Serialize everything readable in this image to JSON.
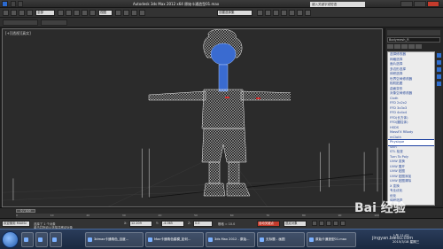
{
  "window": {
    "title": "Autodesk 3ds Max  2012 x64    原始卡通造型01.max",
    "search_placeholder": "键入关键字或短语"
  },
  "toolbar": {
    "selection_filter": "全部",
    "view_dropdown": "视图",
    "named_selection": "创建选择集"
  },
  "viewport": {
    "label": "[+][透视][真实]"
  },
  "command_panel": {
    "object_name": "Bodymesh_R",
    "modifier_list": [
      "选择修改器",
      "网格选择",
      "面片选择",
      "多边形选择",
      "体积选择",
      "世界空间修改器",
      "相机贴图",
      "曲面变形",
      "对象空间修改器",
      "Cloth",
      "FFD 2x2x2",
      "FFD 3x3x3",
      "FFD 4x4x4",
      "FFD(长方体)",
      "FFD(圆柱体)",
      "HSDS",
      "MassFX RBody",
      "mCloth",
      "Physique",
      "Skin",
      "STL 检查",
      "Turn To Poly",
      "UVW 变换",
      "UVW 展开",
      "UVW 贴图",
      "UVW 贴图添加",
      "UVW 贴图清除",
      "X 变换",
      "专业优化",
      "优化",
      "体积选择"
    ],
    "selected_index": 18
  },
  "timeline": {
    "frame_indicator": "0 / 100",
    "ticks": [
      "0",
      "10",
      "20",
      "30",
      "40",
      "50",
      "60",
      "70",
      "80",
      "90",
      "100"
    ]
  },
  "statusbar": {
    "script_field": "欢迎使用 MAXSc",
    "selected": "选择了 1 个对象",
    "prompt": "单击并拖动以选择并移动对象",
    "x_label": "X:",
    "x_value": "12.209",
    "y_label": "Y:",
    "y_value": "-4.065",
    "z_label": "Z:",
    "z_value": "0.0",
    "grid": "栅格 = 10.0",
    "autokey": "自动关键点",
    "select_dropdown": "选定对象"
  },
  "taskbar": {
    "items": [
      "3dmax卡通角色_百度...",
      "Max卡通角色建模_如何...",
      "3ds Max 2012 - 原始...",
      "无标题 - 画图",
      "原始卡通造型01.max"
    ],
    "clock_time": "上午 11:02",
    "clock_date": "2015/3/18 星期三"
  },
  "watermark": {
    "brand": "Bai 经验",
    "url": "jingyan.baidu.com"
  },
  "colors": {
    "selection_blue": "#1a3ea0",
    "mesh_white": "#e8e8e8",
    "taskbar_blue": "#1a2940"
  }
}
